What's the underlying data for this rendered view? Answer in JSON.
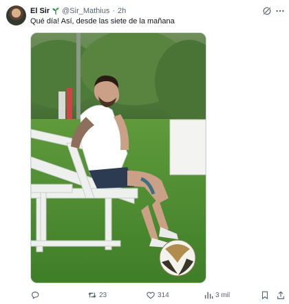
{
  "tweet": {
    "display_name": "El Sir",
    "handle": "@Sir_Mathius",
    "separator": "·",
    "time": "2h",
    "text": "Qué día! Así, desde las siete de la mañana"
  },
  "actions": {
    "replies": "",
    "retweets": "23",
    "likes": "314",
    "views": "3 mil"
  },
  "icons": {
    "name_badge": "sprout-icon",
    "header_right": [
      "grok-icon",
      "more-icon"
    ],
    "action_bar": [
      "reply-icon",
      "retweet-icon",
      "like-icon",
      "views-icon",
      "bookmark-icon",
      "share-icon"
    ]
  },
  "colors": {
    "text_primary": "#0f1419",
    "text_secondary": "#536471",
    "sprout": "#2e8b3e"
  }
}
